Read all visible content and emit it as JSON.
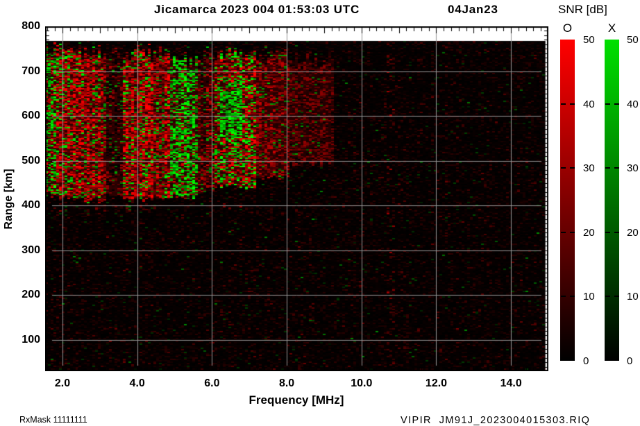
{
  "header": {
    "title": "Jicamarca 2023 004 01:53:03 UTC",
    "date": "04Jan23"
  },
  "axes": {
    "x": {
      "label": "Frequency [MHz]",
      "tick_values": [
        2,
        4,
        6,
        8,
        10,
        12,
        14
      ],
      "tick_labels": [
        "2.0",
        "4.0",
        "6.0",
        "8.0",
        "10.0",
        "12.0",
        "14.0"
      ]
    },
    "y": {
      "label": "Range [km]",
      "tick_values": [
        800,
        700,
        600,
        500,
        400,
        300,
        200,
        100
      ],
      "tick_labels": [
        "800",
        "700",
        "600",
        "500",
        "400",
        "300",
        "200",
        "100"
      ]
    }
  },
  "colorbar": {
    "title": "SNR [dB]",
    "o_label": "O",
    "x_label": "X",
    "tick_labels": [
      "50",
      "40",
      "30",
      "20",
      "10",
      "0"
    ],
    "o_color": "#ff0000",
    "x_color": "#00e000",
    "bottom_color": "#000000",
    "range_db": [
      0,
      50
    ]
  },
  "footer": {
    "rx_mask": "RxMask 11111111",
    "file_id": "VIPIR  JM91J_2023004015303.RIQ"
  },
  "chart_data": {
    "type": "heatmap",
    "title": "Jicamarca 2023 004 01:53:03 UTC  04Jan23",
    "xlabel": "Frequency [MHz]",
    "ylabel": "Range [km]",
    "xlim": [
      1.54,
      14.93
    ],
    "ylim": [
      30,
      800
    ],
    "data_top_km": 769,
    "grid": true,
    "legend_position": "right",
    "snr_scale_db": {
      "min": 0,
      "max": 50,
      "ticks": [
        0,
        10,
        20,
        30,
        40,
        50
      ]
    },
    "modes": [
      {
        "name": "O",
        "color": "#ff0000"
      },
      {
        "name": "X",
        "color": "#00e000"
      }
    ],
    "background": "#000000",
    "echo_bands": [
      {
        "f0": 1.53,
        "f1": 1.82,
        "r0": 415,
        "r1": 772,
        "pO": 0.26,
        "pX": 0.44,
        "oB": 0.8,
        "xB": 0.95
      },
      {
        "f0": 1.82,
        "f1": 2.3,
        "r0": 408,
        "r1": 772,
        "pO": 0.5,
        "pX": 0.2,
        "oB": 0.9,
        "xB": 0.85
      },
      {
        "f0": 2.3,
        "f1": 3.15,
        "r0": 405,
        "r1": 770,
        "pO": 0.56,
        "pX": 0.15,
        "oB": 0.95,
        "xB": 0.85
      },
      {
        "f0": 3.15,
        "f1": 3.6,
        "r0": 415,
        "r1": 766,
        "pO": 0.18,
        "pX": 0.06,
        "oB": 0.5,
        "xB": 0.55
      },
      {
        "f0": 3.6,
        "f1": 4.85,
        "r0": 405,
        "r1": 768,
        "pO": 0.56,
        "pX": 0.16,
        "oB": 0.95,
        "xB": 0.9
      },
      {
        "f0": 4.85,
        "f1": 5.65,
        "r0": 412,
        "r1": 748,
        "pO": 0.18,
        "pX": 0.52,
        "oB": 0.7,
        "xB": 1.0
      },
      {
        "f0": 5.65,
        "f1": 6.08,
        "r0": 425,
        "r1": 762,
        "pO": 0.3,
        "pX": 0.09,
        "oB": 0.7,
        "xB": 0.6
      },
      {
        "f0": 6.08,
        "f1": 7.2,
        "r0": 435,
        "r1": 768,
        "pO": 0.42,
        "pX": 0.28,
        "oB": 0.9,
        "xB": 0.95
      },
      {
        "f0": 6.22,
        "f1": 6.8,
        "r0": 545,
        "r1": 700,
        "pO": 0.08,
        "pX": 0.66,
        "oB": 0.6,
        "xB": 1.0
      },
      {
        "f0": 7.2,
        "f1": 8.05,
        "r0": 455,
        "r1": 758,
        "pO": 0.46,
        "pX": 0.07,
        "oB": 0.62,
        "xB": 0.6
      },
      {
        "f0": 8.05,
        "f1": 9.25,
        "r0": 485,
        "r1": 752,
        "pO": 0.4,
        "pX": 0.03,
        "oB": 0.42,
        "xB": 0.5
      },
      {
        "f0": 1.53,
        "f1": 7.6,
        "r0": 382,
        "r1": 407,
        "pO": 0.3,
        "pX": 0.05,
        "oB": 0.45,
        "xB": 0.4
      }
    ],
    "interference_stripes": [
      {
        "f0": 10.7,
        "f1": 10.92,
        "boost": 2.6
      },
      {
        "f0": 8.3,
        "f1": 8.45,
        "boost": 1.7
      },
      {
        "f0": 12.55,
        "f1": 12.63,
        "boost": 1.5
      }
    ],
    "noise": {
      "p_black": 0.78,
      "p_dim_red": 0.95,
      "p_red": 0.985,
      "p_dim_green": 0.997
    }
  }
}
